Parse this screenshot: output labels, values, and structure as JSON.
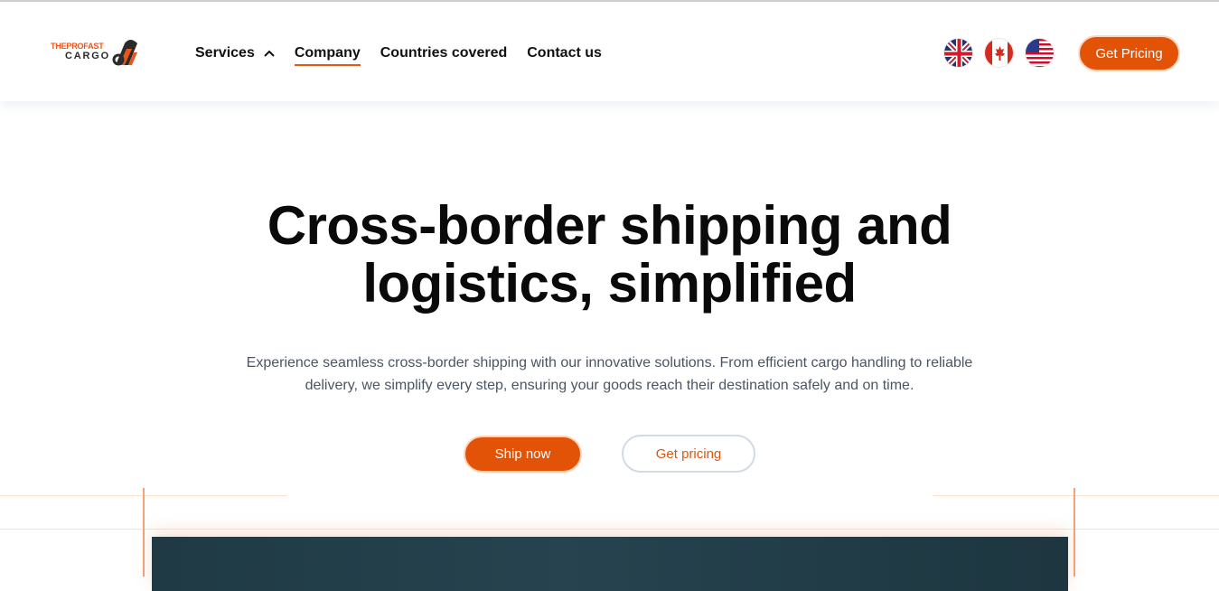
{
  "brand": {
    "logo_line1": "THEPROFAST",
    "logo_line2": "CARGO",
    "accent_color": "#e25307"
  },
  "nav": {
    "items": [
      {
        "label": "Services",
        "has_dropdown": true,
        "icon": "chevron-up-icon"
      },
      {
        "label": "Company",
        "active": true
      },
      {
        "label": "Countries covered"
      },
      {
        "label": "Contact us"
      }
    ]
  },
  "flags": [
    {
      "icon": "uk-flag-icon"
    },
    {
      "icon": "canada-flag-icon"
    },
    {
      "icon": "us-flag-icon"
    }
  ],
  "header_cta": {
    "label": "Get Pricing"
  },
  "hero": {
    "title_line1": "Cross-border shipping and",
    "title_line2": "logistics, simplified",
    "subtitle": "Experience seamless cross-border shipping with our innovative solutions. From efficient cargo handling to reliable delivery, we simplify every step, ensuring your goods reach their destination safely and on time.",
    "primary_button": "Ship now",
    "secondary_button": "Get pricing"
  }
}
